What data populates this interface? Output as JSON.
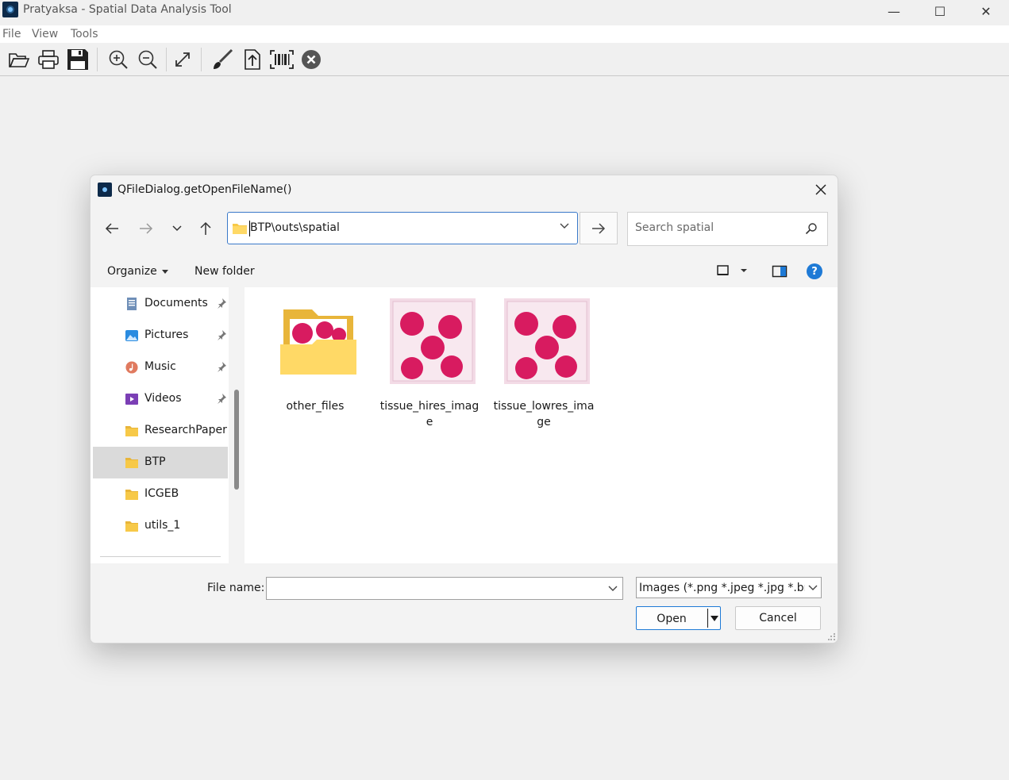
{
  "app": {
    "title": "Pratyaksa - Spatial Data Analysis Tool",
    "window_controls": {
      "minimize": "—",
      "maximize": "☐",
      "close": "✕"
    }
  },
  "menu": [
    "File",
    "View",
    "Tools"
  ],
  "toolbar_icons": [
    "open-folder-icon",
    "print-icon",
    "save-icon",
    "zoom-in-icon",
    "zoom-out-icon",
    "fit-screen-icon",
    "brush-icon",
    "export-icon",
    "barcode-icon",
    "close-circle-icon"
  ],
  "dialog": {
    "title": "QFileDialog.getOpenFileName()",
    "address": "BTP\\outs\\spatial",
    "search_placeholder": "Search spatial",
    "organize_label": "Organize",
    "new_folder_label": "New folder",
    "help_label": "?",
    "nav_items": [
      {
        "label": "Documents",
        "icon": "documents-icon",
        "pinned": true,
        "selected": false
      },
      {
        "label": "Pictures",
        "icon": "pictures-icon",
        "pinned": true,
        "selected": false
      },
      {
        "label": "Music",
        "icon": "music-icon",
        "pinned": true,
        "selected": false
      },
      {
        "label": "Videos",
        "icon": "videos-icon",
        "pinned": true,
        "selected": false
      },
      {
        "label": "ResearchPaper",
        "icon": "folder-icon",
        "pinned": false,
        "selected": false
      },
      {
        "label": "BTP",
        "icon": "folder-icon",
        "pinned": false,
        "selected": true
      },
      {
        "label": "ICGEB",
        "icon": "folder-icon",
        "pinned": false,
        "selected": false
      },
      {
        "label": "utils_1",
        "icon": "folder-icon",
        "pinned": false,
        "selected": false
      }
    ],
    "files": [
      {
        "name": "other_files",
        "kind": "folder"
      },
      {
        "name": "tissue_hires_image",
        "kind": "image"
      },
      {
        "name": "tissue_lowres_image",
        "kind": "image"
      }
    ],
    "file_name_label": "File name:",
    "file_name_value": "",
    "filter": "Images (*.png *.jpeg *.jpg *.bmp",
    "open_label": "Open",
    "cancel_label": "Cancel"
  },
  "colors": {
    "accent": "#1e7ad6",
    "folder": "#f7c948",
    "tissue": "#d81b60",
    "selected_nav": "#dadada"
  }
}
